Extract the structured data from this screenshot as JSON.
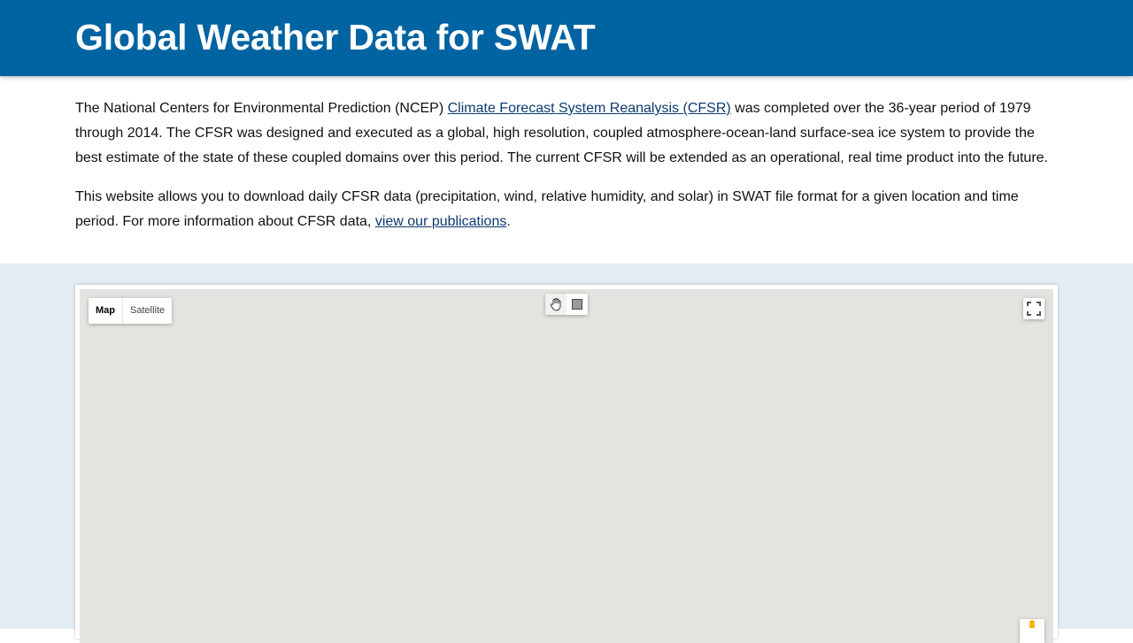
{
  "header": {
    "title": "Global Weather Data for SWAT"
  },
  "intro": {
    "p1_before": "The National Centers for Environmental Prediction (NCEP) ",
    "p1_link": "Climate Forecast System Reanalysis (CFSR)",
    "p1_after": " was completed over the 36-year period of 1979 through 2014. The CFSR was designed and executed as a global, high resolution, coupled atmosphere-ocean-land surface-sea ice system to provide the best estimate of the state of these coupled domains over this period. The current CFSR will be extended as an operational, real time product into the future.",
    "p2_before": "This website allows you to download daily CFSR data (precipitation, wind, relative humidity, and solar) in SWAT file format for a given location and time period. For more information about CFSR data, ",
    "p2_link": "view our publications",
    "p2_after": "."
  },
  "map": {
    "type_options": [
      "Map",
      "Satellite"
    ],
    "selected_type": "Map",
    "tools": [
      "hand-icon",
      "rectangle-icon"
    ],
    "controls": [
      "fullscreen-icon",
      "pegman-icon"
    ]
  },
  "colors": {
    "header_bg": "#0063a2",
    "map_section_bg": "#e2ecf2",
    "map_canvas_bg": "#e5e3df",
    "link": "#0b3a6e"
  }
}
